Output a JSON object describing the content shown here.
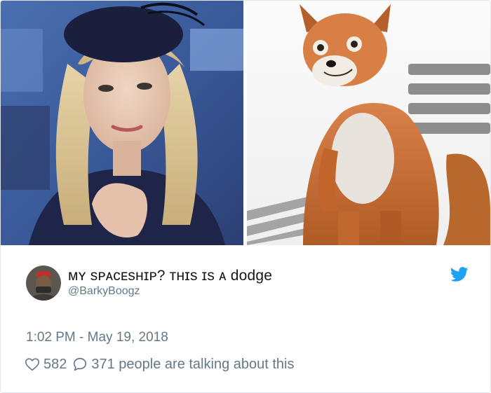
{
  "tweet": {
    "display_name": "ᴍʏ sᴘᴀᴄᴇsʜɪᴘ? ᴛʜɪs ɪs ᴀ dodge",
    "handle": "@BarkyBoogz",
    "timestamp": "1:02 PM - May 19, 2018",
    "likes": "582",
    "replies": "371 people are talking about this"
  },
  "icons": {
    "brand": "twitter-bird-icon",
    "like": "heart-icon",
    "reply": "speech-bubble-icon"
  },
  "colors": {
    "twitter_blue": "#1da1f2",
    "secondary_text": "#657786",
    "primary_text": "#14171a",
    "border": "#e1e8ed"
  }
}
